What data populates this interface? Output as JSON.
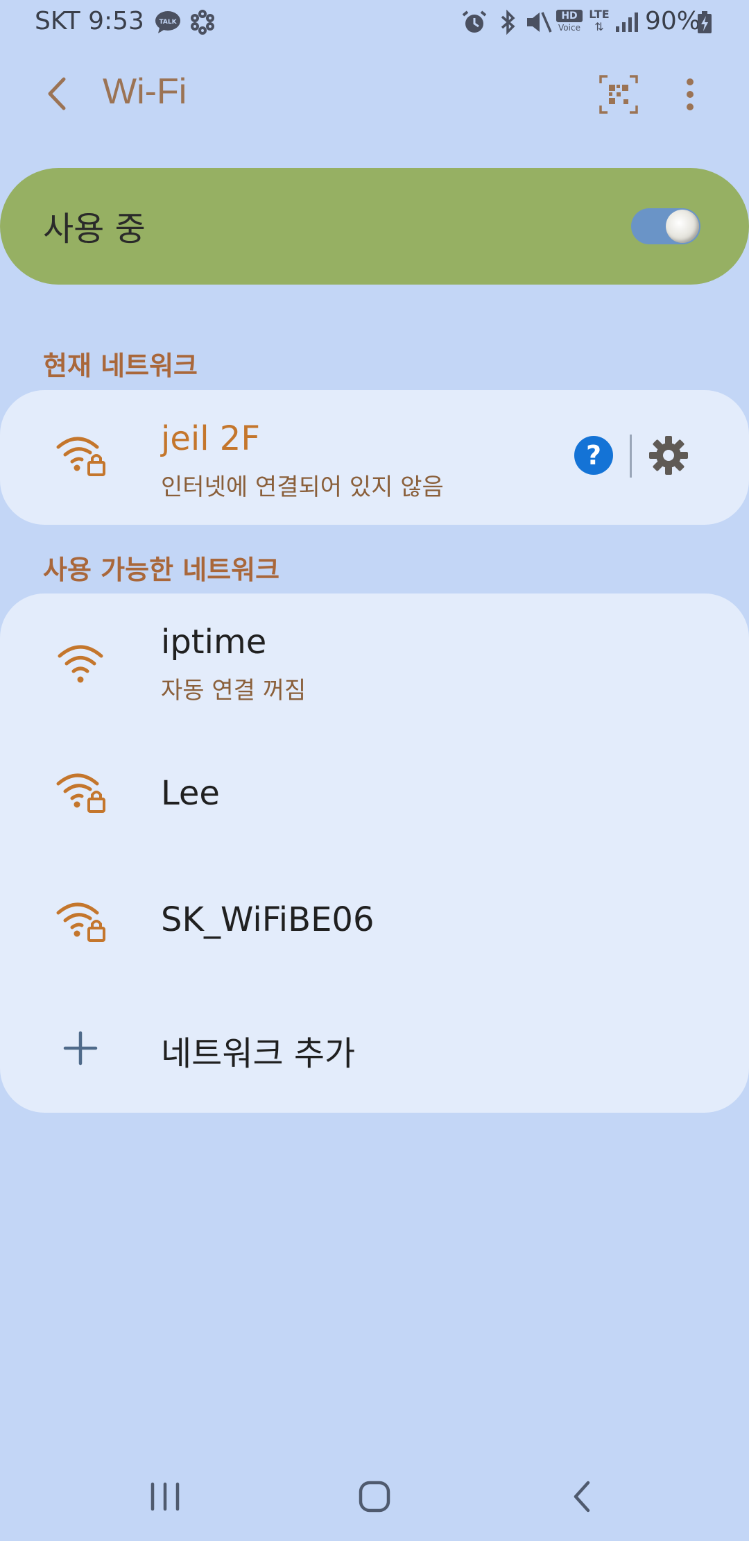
{
  "status_bar": {
    "carrier_time": "SKT 9:53",
    "battery": "90%",
    "left_icons": [
      "talk-icon",
      "flower-icon"
    ],
    "right_icons": [
      "alarm-icon",
      "bluetooth-icon",
      "mute-icon",
      "hd-voice-icon",
      "lte-icon",
      "signal-icon",
      "battery-charging-icon"
    ],
    "hd_label": "HD",
    "voice_label": "Voice",
    "lte_label": "LTE"
  },
  "app_bar": {
    "title": "Wi-Fi",
    "icons": [
      "back-arrow-icon",
      "qr-code-icon",
      "more-options-icon"
    ]
  },
  "master_toggle": {
    "label": "사용 중",
    "state": "on"
  },
  "current_network": {
    "header": "현재 네트워크",
    "name": "jeil 2F",
    "status": "인터넷에 연결되어 있지 않음",
    "help_label": "?",
    "icons": [
      "wifi-lock-icon",
      "help-icon",
      "settings-gear-icon"
    ]
  },
  "available_networks": {
    "header": "사용 가능한 네트워크",
    "items": [
      {
        "name": "iptime",
        "status": "자동 연결 꺼짐",
        "secured": false
      },
      {
        "name": "Lee",
        "status": "",
        "secured": true
      },
      {
        "name": "SK_WiFiBE06",
        "status": "",
        "secured": true
      }
    ],
    "add_label": "네트워크 추가"
  },
  "nav_bar": {
    "icons": [
      "recent-apps-icon",
      "home-icon",
      "back-icon"
    ]
  },
  "colors": {
    "background": "#c3d6f6",
    "card": "#e3ecfb",
    "toggle_card": "#96b063",
    "accent_orange": "#c4762c",
    "help_blue": "#1473d6"
  }
}
